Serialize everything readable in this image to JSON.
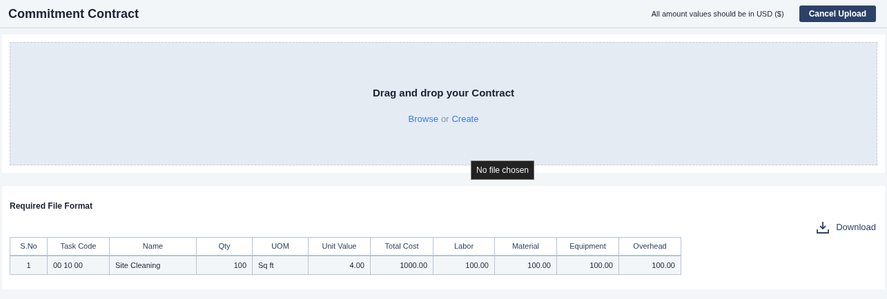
{
  "header": {
    "title": "Commitment Contract",
    "note": "All amount values should be in USD ($)",
    "cancel_button": "Cancel Upload"
  },
  "dropzone": {
    "heading": "Drag and drop your Contract",
    "browse_link": "Browse",
    "separator": "or",
    "create_link": "Create",
    "tooltip": "No file chosen"
  },
  "format": {
    "title": "Required File Format",
    "download": "Download",
    "table": {
      "columns": [
        "S.No",
        "Task Code",
        "Name",
        "Qty",
        "UOM",
        "Unit Value",
        "Total Cost",
        "Labor",
        "Material",
        "Equipment",
        "Overhead"
      ],
      "rows": [
        [
          "1",
          "00 10 00",
          "Site Cleaning",
          "100",
          "Sq ft",
          "4.00",
          "1000.00",
          "100.00",
          "100.00",
          "100.00",
          "100.00"
        ]
      ]
    }
  }
}
